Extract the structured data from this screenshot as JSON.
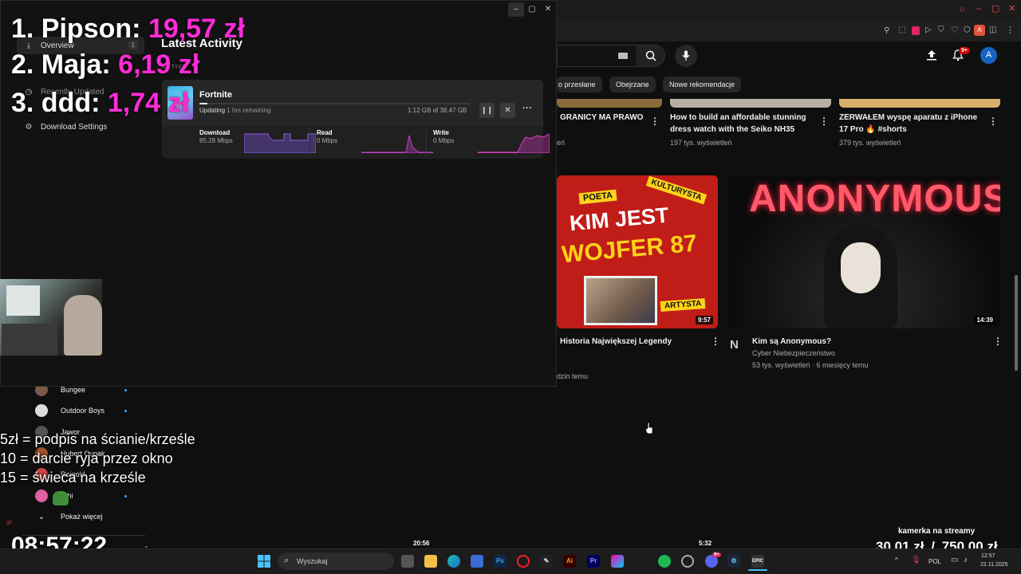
{
  "youtube": {
    "chips": [
      "o przesłane",
      "Obejrzane",
      "Nowe rekomendacje"
    ],
    "notification_badge": "9+",
    "avatar_letter": "A",
    "row1": [
      {
        "title_l1": "GRANICY MA PRAWO",
        "title_l2": "",
        "meta": "eń"
      },
      {
        "title_l1": "How to build an affordable stunning",
        "title_l2": "dress watch with the Seiko NH35",
        "meta": "197 tys. wyświetleń"
      },
      {
        "title_l1": "ZERWAŁEM wyspę aparatu z iPhone",
        "title_l2": "17 Pro 🔥 #shorts",
        "meta": "379 tys. wyświetleń"
      }
    ],
    "video_left": {
      "thumb_words": [
        "POETA",
        "KULTURYSTA",
        "KIM JEST",
        "WOJFER 87",
        "ARTYSTA"
      ],
      "duration": "9:57",
      "title": "Historia Największej Legendy",
      "meta": "dzin temu"
    },
    "video_right": {
      "thumb_word": "ANONYMOUS",
      "duration": "14:39",
      "title": "Kim są Anonymous?",
      "channel": "Cyber Niebezpieczeństwo",
      "meta": "53 tys. wyświetleń · 6 miesięcy temu",
      "channel_logo": "N"
    },
    "subscriptions": [
      "Bungee",
      "Outdoor Boys",
      "Jawor",
      "Hubert Cupak",
      "Reinold",
      "shi"
    ],
    "show_more": "Pokaż więcej"
  },
  "epic": {
    "nav": [
      {
        "label": "Overview",
        "badge": "1",
        "icon": "download-icon"
      },
      {
        "label": "Recently Updated",
        "icon": "clock-icon"
      },
      {
        "label": "Download Settings",
        "icon": "gear-icon"
      }
    ],
    "heading": "Latest Activity",
    "section_label": "ACTIVE",
    "game": {
      "name": "Fortnite",
      "status": "Updating",
      "remaining": "1 hrs remaining",
      "size": "1.12 GB of 38.47 GB",
      "progress": 0.03
    },
    "stats": [
      {
        "label": "Download",
        "value": "85.28 Mbps"
      },
      {
        "label": "Read",
        "value": "0 Mbps"
      },
      {
        "label": "Write",
        "value": "0 Mbps"
      }
    ]
  },
  "overlay": {
    "ranking": [
      {
        "name": "1. Pipson: ",
        "amount": "19,57 zł"
      },
      {
        "name": "2. Maja: ",
        "amount": "6,19 zł"
      },
      {
        "name": "3. ddd: ",
        "amount": "1,74 zł"
      }
    ],
    "rules": [
      "5zł = podpis na ścianie/krześle",
      "10 = darcie ryja przez okno",
      "15 = świeca na krześle"
    ],
    "clock": "08:57:22",
    "timer_a": "20:56",
    "timer_b": "5:32",
    "goal_label": "kamerka na streamy",
    "goal_progress": "30,01 zł",
    "goal_sep": "/",
    "goal_target": "750,00 zł"
  },
  "taskbar": {
    "search_placeholder": "Wyszukaj",
    "lang": "POL",
    "time": "12:57",
    "date": "22.11.2025",
    "discord_badge": "9+"
  },
  "colors": {
    "accent_pink": "#ff2bd6",
    "youtube_red": "#ff0000",
    "graph_purple": "#8a5cf0"
  }
}
